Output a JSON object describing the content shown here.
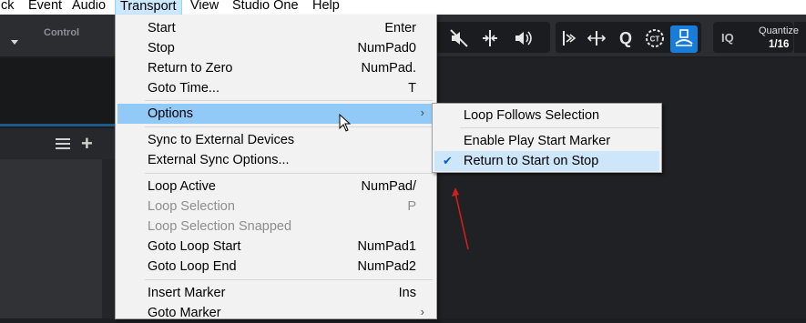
{
  "menubar": {
    "items": [
      {
        "label": "ck"
      },
      {
        "label": "Event"
      },
      {
        "label": "Audio"
      },
      {
        "label": "Transport"
      },
      {
        "label": "View"
      },
      {
        "label": "Studio One"
      },
      {
        "label": "Help"
      }
    ]
  },
  "toolbar": {
    "control_label": "Control",
    "iq_label": "IQ",
    "quantize_label": "Quantize",
    "quantize_value": "1/16"
  },
  "transport_menu": {
    "items": [
      {
        "label": "Start",
        "shortcut": "Enter"
      },
      {
        "label": "Stop",
        "shortcut": "NumPad0"
      },
      {
        "label": "Return to Zero",
        "shortcut": "NumPad."
      },
      {
        "label": "Goto Time...",
        "shortcut": "T"
      },
      {
        "label": "Options",
        "shortcut": ""
      },
      {
        "label": "Sync to External Devices",
        "shortcut": ""
      },
      {
        "label": "External Sync Options...",
        "shortcut": ""
      },
      {
        "label": "Loop Active",
        "shortcut": "NumPad/"
      },
      {
        "label": "Loop Selection",
        "shortcut": "P"
      },
      {
        "label": "Loop Selection Snapped",
        "shortcut": ""
      },
      {
        "label": "Goto Loop Start",
        "shortcut": "NumPad1"
      },
      {
        "label": "Goto Loop End",
        "shortcut": "NumPad2"
      },
      {
        "label": "Insert Marker",
        "shortcut": "Ins"
      },
      {
        "label": "Goto Marker",
        "shortcut": ""
      }
    ]
  },
  "options_submenu": {
    "items": [
      {
        "label": "Loop Follows Selection",
        "checked": false
      },
      {
        "label": "Enable Play Start Marker",
        "checked": false
      },
      {
        "label": "Return to Start on Stop",
        "checked": true
      }
    ]
  },
  "colors": {
    "highlight": "#91c9f7",
    "accent": "#1a7cd9",
    "annotation_arrow": "#d21e1e"
  }
}
